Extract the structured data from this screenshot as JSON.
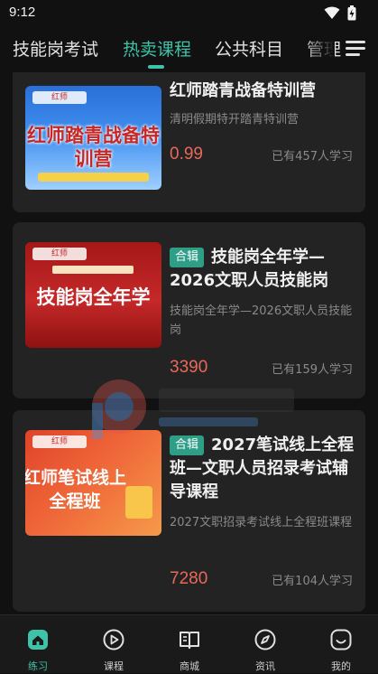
{
  "status_bar": {
    "time": "9:12"
  },
  "tabs": [
    {
      "label": "技能岗考试",
      "active": false
    },
    {
      "label": "热卖课程",
      "active": true
    },
    {
      "label": "公共科目",
      "active": false
    },
    {
      "label": "管理",
      "active": false
    }
  ],
  "courses": [
    {
      "thumb_text": "红师踏青战备特训营",
      "title": "红师踏青战备特训营",
      "subtitle": "清明假期特开踏青特训营",
      "price": "0.99",
      "learners": "已有457人学习",
      "tag": ""
    },
    {
      "thumb_text": "技能岗全年学",
      "title": "技能岗全年学—2026文职人员技能岗",
      "subtitle": "技能岗全年学—2026文职人员技能岗",
      "price": "3390",
      "learners": "已有159人学习",
      "tag": "合辑"
    },
    {
      "thumb_text": "红师笔试线上全程班",
      "title": "2027笔试线上全程班—文职人员招录考试辅导课程",
      "subtitle": "2027文职招录考试线上全程班课程",
      "price": "7280",
      "learners": "已有104人学习",
      "tag": "合辑"
    }
  ],
  "bottom_nav": [
    {
      "label": "练习",
      "icon": "home-icon",
      "active": true
    },
    {
      "label": "课程",
      "icon": "play-circle-icon",
      "active": false
    },
    {
      "label": "商城",
      "icon": "book-icon",
      "active": false
    },
    {
      "label": "资讯",
      "icon": "compass-icon",
      "active": false
    },
    {
      "label": "我的",
      "icon": "smile-icon",
      "active": false
    }
  ],
  "colors": {
    "accent": "#3ec3a8",
    "price": "#e8695a",
    "card_bg": "#232323",
    "page_bg": "#111111"
  }
}
